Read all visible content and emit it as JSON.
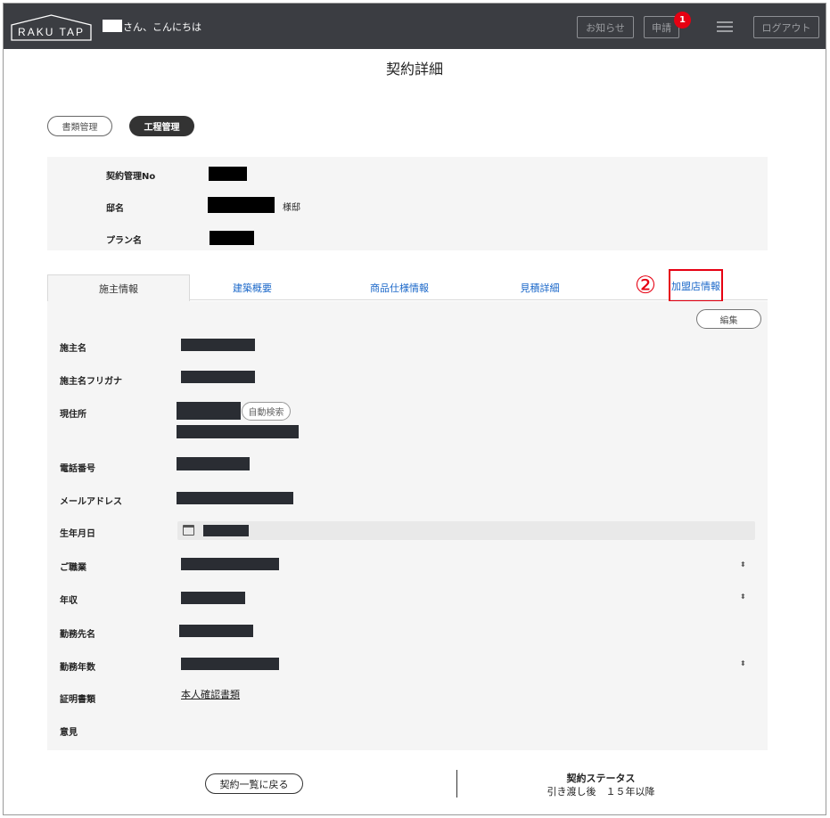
{
  "header": {
    "logo": "RAKU TAP",
    "greeting": "さん、こんにちは",
    "news_label": "お知らせ",
    "apply_label": "申請",
    "apply_badge": "1",
    "logout_label": "ログアウト"
  },
  "page": {
    "title": "契約詳細"
  },
  "mode_buttons": {
    "docs": "書類管理",
    "process": "工程管理"
  },
  "summary": {
    "contract_no_label": "契約管理No",
    "house_name_label": "邸名",
    "house_suffix": "様邸",
    "plan_label": "プラン名"
  },
  "tabs": [
    {
      "label": "施主情報",
      "active": true
    },
    {
      "label": "建築概要",
      "active": false
    },
    {
      "label": "商品仕様情報",
      "active": false
    },
    {
      "label": "見積詳細",
      "active": false
    },
    {
      "label": "加盟店情報",
      "active": false,
      "highlighted": true
    }
  ],
  "step_marker": "②",
  "detail": {
    "edit_label": "編集",
    "fields": {
      "owner_name": "施主名",
      "owner_kana": "施主名フリガナ",
      "address": "現住所",
      "auto_search": "自動検索",
      "phone": "電話番号",
      "email": "メールアドレス",
      "birthdate": "生年月日",
      "occupation": "ご職業",
      "income": "年収",
      "employer": "勤務先名",
      "years_employed": "勤務年数",
      "id_documents": "証明書類",
      "id_documents_link": "本人確認書類",
      "opinion": "意見"
    }
  },
  "footer": {
    "back_label": "契約一覧に戻る",
    "status_title": "契約ステータス",
    "status_value": "引き渡し後　１５年以降"
  },
  "colors": {
    "header_bg": "#3b3d42",
    "accent_red": "#e60012",
    "link_blue": "#1a67c9",
    "panel_bg": "#f5f5f5"
  }
}
